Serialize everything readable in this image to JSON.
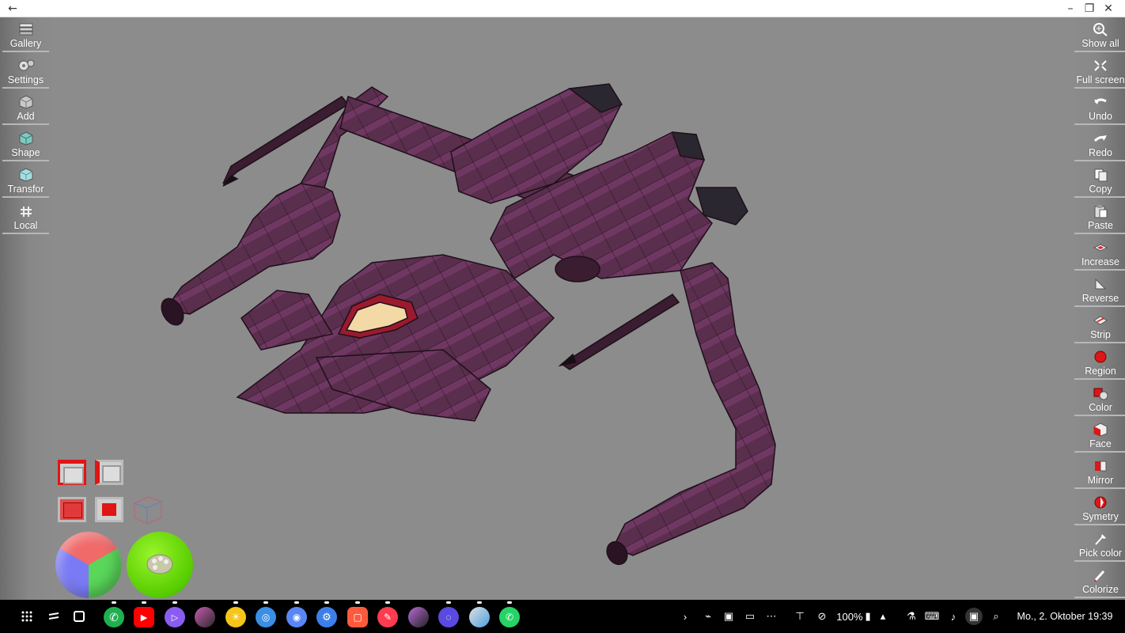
{
  "window": {
    "back_icon": "arrow-left-icon",
    "minimize_icon": "minimize-icon",
    "restore_icon": "restore-icon",
    "close_icon": "close-icon"
  },
  "left_toolbar": {
    "items": [
      {
        "label": "Gallery",
        "icon": "gallery-icon"
      },
      {
        "label": "Settings",
        "icon": "settings-icon"
      },
      {
        "label": "Add",
        "icon": "add-cube-icon"
      },
      {
        "label": "Shape",
        "icon": "shape-icon"
      },
      {
        "label": "Transfor",
        "icon": "transform-icon"
      },
      {
        "label": "Local",
        "icon": "local-icon"
      }
    ]
  },
  "right_toolbar": {
    "items": [
      {
        "label": "Show all",
        "icon": "zoom-icon"
      },
      {
        "label": "Full screen",
        "icon": "fullscreen-icon"
      },
      {
        "label": "Undo",
        "icon": "undo-icon"
      },
      {
        "label": "Redo",
        "icon": "redo-icon"
      },
      {
        "label": "Copy",
        "icon": "copy-icon"
      },
      {
        "label": "Paste",
        "icon": "paste-icon"
      },
      {
        "label": "Increase",
        "icon": "increase-icon"
      },
      {
        "label": "Reverse",
        "icon": "reverse-icon"
      },
      {
        "label": "Strip",
        "icon": "strip-icon"
      },
      {
        "label": "Region",
        "icon": "region-icon"
      },
      {
        "label": "Color",
        "icon": "color-icon"
      },
      {
        "label": "Face",
        "icon": "face-icon"
      },
      {
        "label": "Mirror",
        "icon": "mirror-icon"
      },
      {
        "label": "Symetry",
        "icon": "symmetry-icon"
      },
      {
        "label": "Pick color",
        "icon": "pick-color-icon"
      },
      {
        "label": "Colorize",
        "icon": "colorize-icon"
      }
    ]
  },
  "viewport": {
    "background": "#8c8c8c",
    "model_color": "#5a2e4d",
    "model_stripe_color": "#7a3d6a",
    "canopy_color": "#f2d9a6"
  },
  "bottom_controls": {
    "color_wheel": "rgb-color-ball",
    "palette_button": "palette-icon",
    "palette_color": "#66dd00"
  },
  "taskbar": {
    "apps": [
      {
        "name": "phone-app-icon",
        "color": "#20b050"
      },
      {
        "name": "youtube-app-icon",
        "color": "#ff0000"
      },
      {
        "name": "video-player-app-icon",
        "color": "#8a5cf0"
      },
      {
        "name": "photo-app-icon",
        "color": "#c85ab0"
      },
      {
        "name": "weather-app-icon",
        "color": "#f5c518"
      },
      {
        "name": "browser-app-icon",
        "color": "#3a8ee6"
      },
      {
        "name": "camera-app-icon",
        "color": "#5a86f5"
      },
      {
        "name": "settings-app-icon",
        "color": "#3d7fe8"
      },
      {
        "name": "screen-app-icon",
        "color": "#ff5a3c"
      },
      {
        "name": "paint-app-icon",
        "color": "#ff3b50"
      },
      {
        "name": "photo2-app-icon",
        "color": "#b86bd6"
      },
      {
        "name": "internet-app-icon",
        "color": "#5b4ae0"
      },
      {
        "name": "gallery-app-icon",
        "color": "#e0e0e0"
      },
      {
        "name": "whatsapp-app-icon",
        "color": "#25d366"
      }
    ],
    "battery": "100%",
    "datetime": "Mo., 2. Oktober 19:39"
  }
}
